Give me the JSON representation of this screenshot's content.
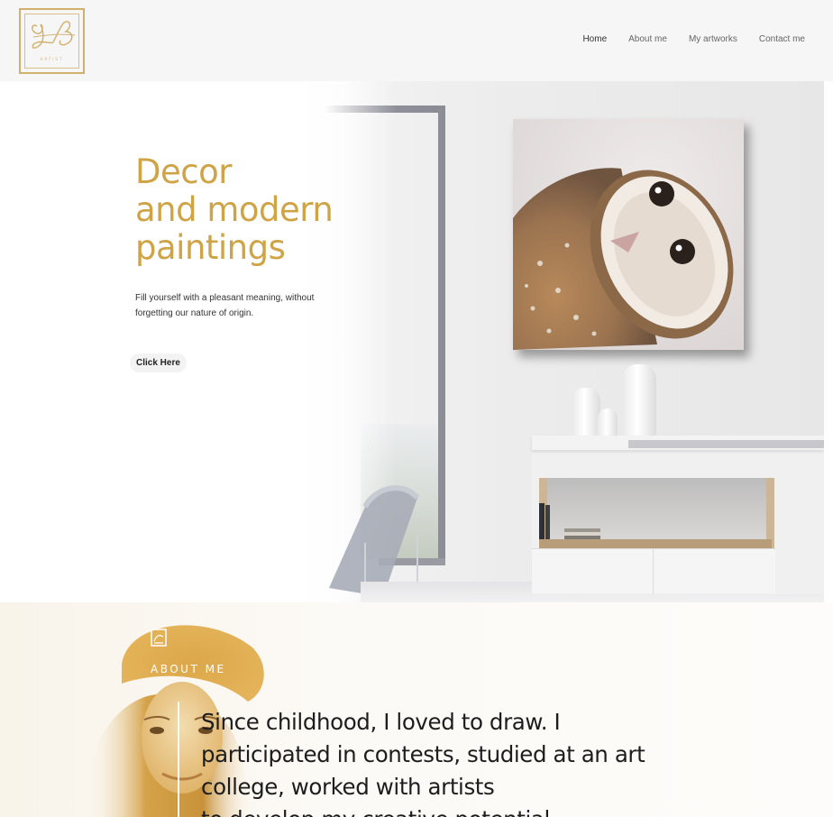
{
  "header": {
    "logo": {
      "monogram": "YB",
      "tagline": "ARTIST"
    },
    "nav": [
      {
        "label": "Home"
      },
      {
        "label": "About me"
      },
      {
        "label": "My artworks"
      },
      {
        "label": "Contact me"
      }
    ]
  },
  "hero": {
    "title": "Decor\nand modern\npaintings",
    "subtitle": "Fill yourself with a pleasant meaning, without forgetting our nature of origin.",
    "button_label": "Click Here"
  },
  "about": {
    "label": "ABOUT ME",
    "text": "Since childhood, I loved to draw. I\nparticipated in contests, studied at an art\ncollege, worked with artists\nto develop my creative potential"
  },
  "colors": {
    "accent_gold": "#cfa446",
    "header_bg": "#f6f6f6",
    "about_bg": "#fcf9f3"
  }
}
